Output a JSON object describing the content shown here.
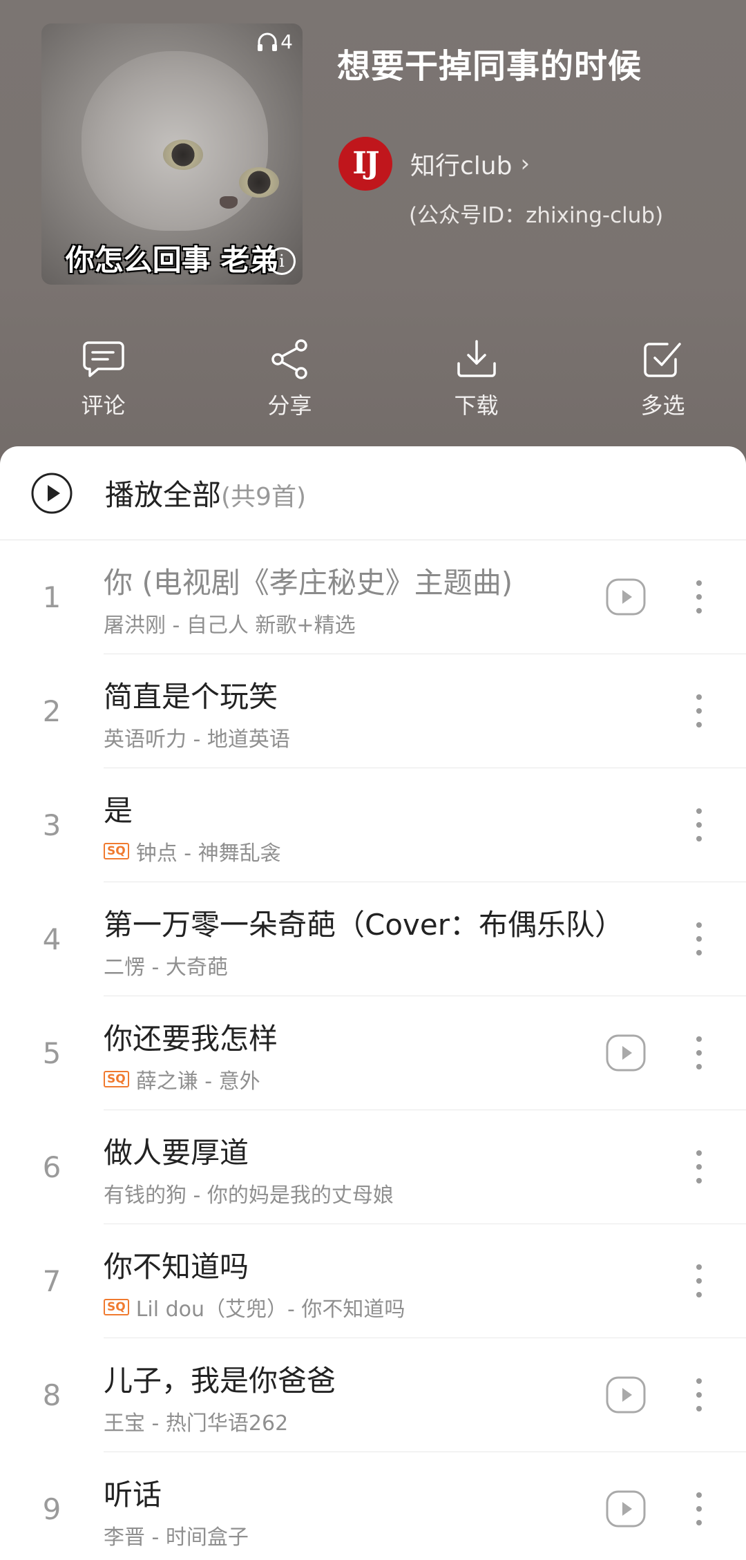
{
  "header": {
    "title": "想要干掉同事的时候",
    "cover": {
      "caption": "你怎么回事 老弟",
      "play_count": "4"
    },
    "author": {
      "avatar_text": "IJ",
      "name": "知行club",
      "id_text": "(公众号ID：zhixing-club)"
    },
    "actions": [
      {
        "label": "评论",
        "icon": "comment-icon"
      },
      {
        "label": "分享",
        "icon": "share-icon"
      },
      {
        "label": "下载",
        "icon": "download-icon"
      },
      {
        "label": "多选",
        "icon": "multiselect-icon"
      }
    ],
    "colors": {
      "header_bg": "#7a7370",
      "avatar_red": "#c0161c",
      "sq_orange": "#f07a2f"
    }
  },
  "playall": {
    "label": "播放全部",
    "count": "(共9首)"
  },
  "songs": [
    {
      "index": "1",
      "title": "你",
      "title_extra": " (电视剧《孝庄秘史》主题曲)",
      "sub": "屠洪刚 - 自己人 新歌+精选",
      "sq": false,
      "mv": true,
      "dim": true
    },
    {
      "index": "2",
      "title": "简直是个玩笑",
      "title_extra": "",
      "sub": "英语听力 - 地道英语",
      "sq": false,
      "mv": false,
      "dim": false
    },
    {
      "index": "3",
      "title": "是",
      "title_extra": "",
      "sub": "钟点 - 神舞乱衾",
      "sq": true,
      "mv": false,
      "dim": false
    },
    {
      "index": "4",
      "title": "第一万零一朵奇葩（Cover：布偶乐队）",
      "title_extra": "",
      "sub": "二愣 - 大奇葩",
      "sq": false,
      "mv": false,
      "dim": false
    },
    {
      "index": "5",
      "title": "你还要我怎样",
      "title_extra": "",
      "sub": "薛之谦 - 意外",
      "sq": true,
      "mv": true,
      "dim": false
    },
    {
      "index": "6",
      "title": "做人要厚道",
      "title_extra": "",
      "sub": "有钱的狗 - 你的妈是我的丈母娘",
      "sq": false,
      "mv": false,
      "dim": false
    },
    {
      "index": "7",
      "title": "你不知道吗",
      "title_extra": "",
      "sub": "Lil dou（艾兜）- 你不知道吗",
      "sq": true,
      "mv": false,
      "dim": false
    },
    {
      "index": "8",
      "title": "儿子，我是你爸爸",
      "title_extra": "",
      "sub": "王宝 - 热门华语262",
      "sq": false,
      "mv": true,
      "dim": false
    },
    {
      "index": "9",
      "title": "听话",
      "title_extra": "",
      "sub": "李晋 - 时间盒子",
      "sq": false,
      "mv": true,
      "dim": false
    }
  ],
  "sq_label": "SQ"
}
